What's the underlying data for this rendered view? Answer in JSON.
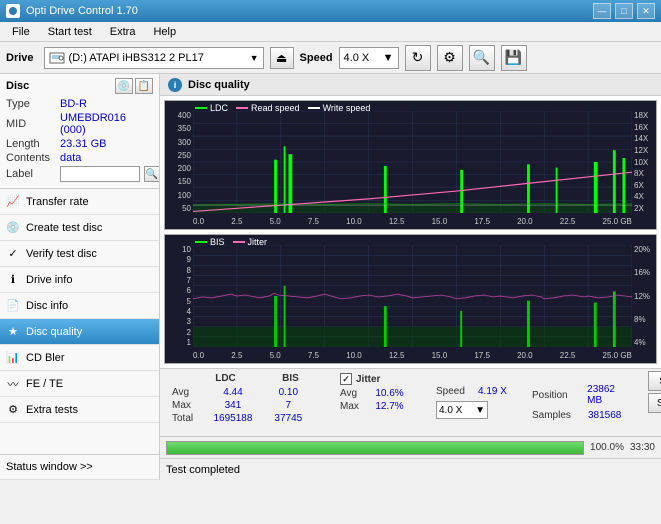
{
  "titleBar": {
    "title": "Opti Drive Control 1.70",
    "minBtn": "—",
    "maxBtn": "□",
    "closeBtn": "✕"
  },
  "menuBar": {
    "items": [
      "File",
      "Start test",
      "Extra",
      "Help"
    ]
  },
  "driveBar": {
    "label": "Drive",
    "driveText": "(D:)  ATAPI iHBS312  2 PL17",
    "speedLabel": "Speed",
    "speedValue": "4.0 X"
  },
  "discPanel": {
    "title": "Disc",
    "typeLabel": "Type",
    "typeValue": "BD-R",
    "midLabel": "MID",
    "midValue": "UMEBDR016 (000)",
    "lengthLabel": "Length",
    "lengthValue": "23.31 GB",
    "contentsLabel": "Contents",
    "contentsValue": "data",
    "labelLabel": "Label",
    "labelValue": ""
  },
  "navItems": [
    {
      "id": "transfer-rate",
      "label": "Transfer rate",
      "icon": "📈",
      "active": false
    },
    {
      "id": "create-test-disc",
      "label": "Create test disc",
      "icon": "💿",
      "active": false
    },
    {
      "id": "verify-test-disc",
      "label": "Verify test disc",
      "icon": "✓",
      "active": false
    },
    {
      "id": "drive-info",
      "label": "Drive info",
      "icon": "ℹ",
      "active": false
    },
    {
      "id": "disc-info",
      "label": "Disc info",
      "icon": "📄",
      "active": false
    },
    {
      "id": "disc-quality",
      "label": "Disc quality",
      "icon": "★",
      "active": true
    },
    {
      "id": "cd-bler",
      "label": "CD Bler",
      "icon": "📊",
      "active": false
    },
    {
      "id": "fe-te",
      "label": "FE / TE",
      "icon": "〰",
      "active": false
    },
    {
      "id": "extra-tests",
      "label": "Extra tests",
      "icon": "⚙",
      "active": false
    }
  ],
  "contentHeader": {
    "title": "Disc quality"
  },
  "chart1": {
    "legend": [
      {
        "label": "LDC",
        "color": "#00ff00"
      },
      {
        "label": "Read speed",
        "color": "#ff69b4"
      },
      {
        "label": "Write speed",
        "color": "#ffffff"
      }
    ],
    "yLabels": [
      "400",
      "350",
      "300",
      "250",
      "200",
      "150",
      "100",
      "50"
    ],
    "yLabelsRight": [
      "18X",
      "16X",
      "14X",
      "12X",
      "10X",
      "8X",
      "6X",
      "4X",
      "2X"
    ],
    "xLabels": [
      "0.0",
      "2.5",
      "5.0",
      "7.5",
      "10.0",
      "12.5",
      "15.0",
      "17.5",
      "20.0",
      "22.5",
      "25.0 GB"
    ]
  },
  "chart2": {
    "legend": [
      {
        "label": "BIS",
        "color": "#00ff00"
      },
      {
        "label": "Jitter",
        "color": "#ff69b4"
      }
    ],
    "yLabels": [
      "10",
      "9",
      "8",
      "7",
      "6",
      "5",
      "4",
      "3",
      "2",
      "1"
    ],
    "yLabelsRight": [
      "20%",
      "16%",
      "12%",
      "8%",
      "4%"
    ],
    "xLabels": [
      "0.0",
      "2.5",
      "5.0",
      "7.5",
      "10.0",
      "12.5",
      "15.0",
      "17.5",
      "20.0",
      "22.5",
      "25.0 GB"
    ]
  },
  "stats": {
    "ldcLabel": "LDC",
    "bisLabel": "BIS",
    "jitterLabel": "Jitter",
    "jitterChecked": true,
    "speedLabel": "Speed",
    "speedValue": "4.19 X",
    "speedSelectValue": "4.0 X",
    "avgLabel": "Avg",
    "ldcAvg": "4.44",
    "bisAvg": "0.10",
    "jitterAvg": "10.6%",
    "maxLabel": "Max",
    "ldcMax": "341",
    "bisMax": "7",
    "jitterMax": "12.7%",
    "totalLabel": "Total",
    "ldcTotal": "1695188",
    "bisTotal": "37745",
    "positionLabel": "Position",
    "positionValue": "23862 MB",
    "samplesLabel": "Samples",
    "samplesValue": "381568",
    "startFullLabel": "Start full",
    "startPartLabel": "Start part"
  },
  "progressBar": {
    "percent": 100,
    "percentLabel": "100.0%",
    "timeLabel": "33:30"
  },
  "statusBar": {
    "text": "Test completed"
  },
  "statusWindow": {
    "label": "Status window >>"
  }
}
